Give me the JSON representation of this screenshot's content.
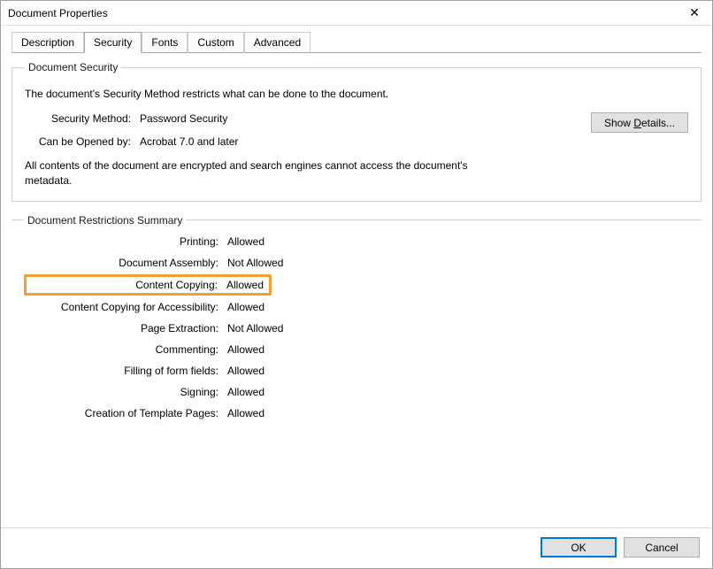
{
  "window": {
    "title": "Document Properties",
    "close_glyph": "✕"
  },
  "tabs": {
    "description": "Description",
    "security": "Security",
    "fonts": "Fonts",
    "custom": "Custom",
    "advanced": "Advanced"
  },
  "security_group": {
    "legend": "Document Security",
    "description": "The document's Security Method restricts what can be done to the document.",
    "method_label": "Security Method:",
    "method_value": "Password Security",
    "opened_label": "Can be Opened by:",
    "opened_value": "Acrobat 7.0 and later",
    "note": "All contents of the document are encrypted and search engines cannot access the document's metadata.",
    "show_details_prefix": "Show ",
    "show_details_underlined": "D",
    "show_details_suffix": "etails..."
  },
  "restrictions": {
    "legend": "Document Restrictions Summary",
    "rows": [
      {
        "label": "Printing:",
        "value": "Allowed"
      },
      {
        "label": "Document Assembly:",
        "value": "Not Allowed"
      },
      {
        "label": "Content Copying:",
        "value": "Allowed"
      },
      {
        "label": "Content Copying for Accessibility:",
        "value": "Allowed"
      },
      {
        "label": "Page Extraction:",
        "value": "Not Allowed"
      },
      {
        "label": "Commenting:",
        "value": "Allowed"
      },
      {
        "label": "Filling of form fields:",
        "value": "Allowed"
      },
      {
        "label": "Signing:",
        "value": "Allowed"
      },
      {
        "label": "Creation of Template Pages:",
        "value": "Allowed"
      }
    ],
    "highlighted_index": 2
  },
  "footer": {
    "ok": "OK",
    "cancel": "Cancel"
  }
}
